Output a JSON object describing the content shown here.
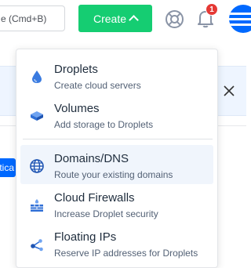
{
  "header": {
    "search_placeholder": "e (Cmd+B)",
    "create_label": "Create",
    "notification_count": "1"
  },
  "page": {
    "partial_button_label": "atica"
  },
  "menu": {
    "items": [
      {
        "title": "Droplets",
        "subtitle": "Create cloud servers",
        "icon": "droplet-icon"
      },
      {
        "title": "Volumes",
        "subtitle": "Add storage to Droplets",
        "icon": "volume-icon"
      },
      {
        "title": "Domains/DNS",
        "subtitle": "Route your existing domains",
        "icon": "globe-icon"
      },
      {
        "title": "Cloud Firewalls",
        "subtitle": "Increase Droplet security",
        "icon": "firewall-icon"
      },
      {
        "title": "Floating IPs",
        "subtitle": "Reserve IP addresses for Droplets",
        "icon": "floating-ip-icon"
      }
    ]
  },
  "colors": {
    "create_button": "#15cd72",
    "brand_blue": "#0069ff",
    "badge_red": "#e53935",
    "active_item_bg": "#f0f5fc"
  }
}
